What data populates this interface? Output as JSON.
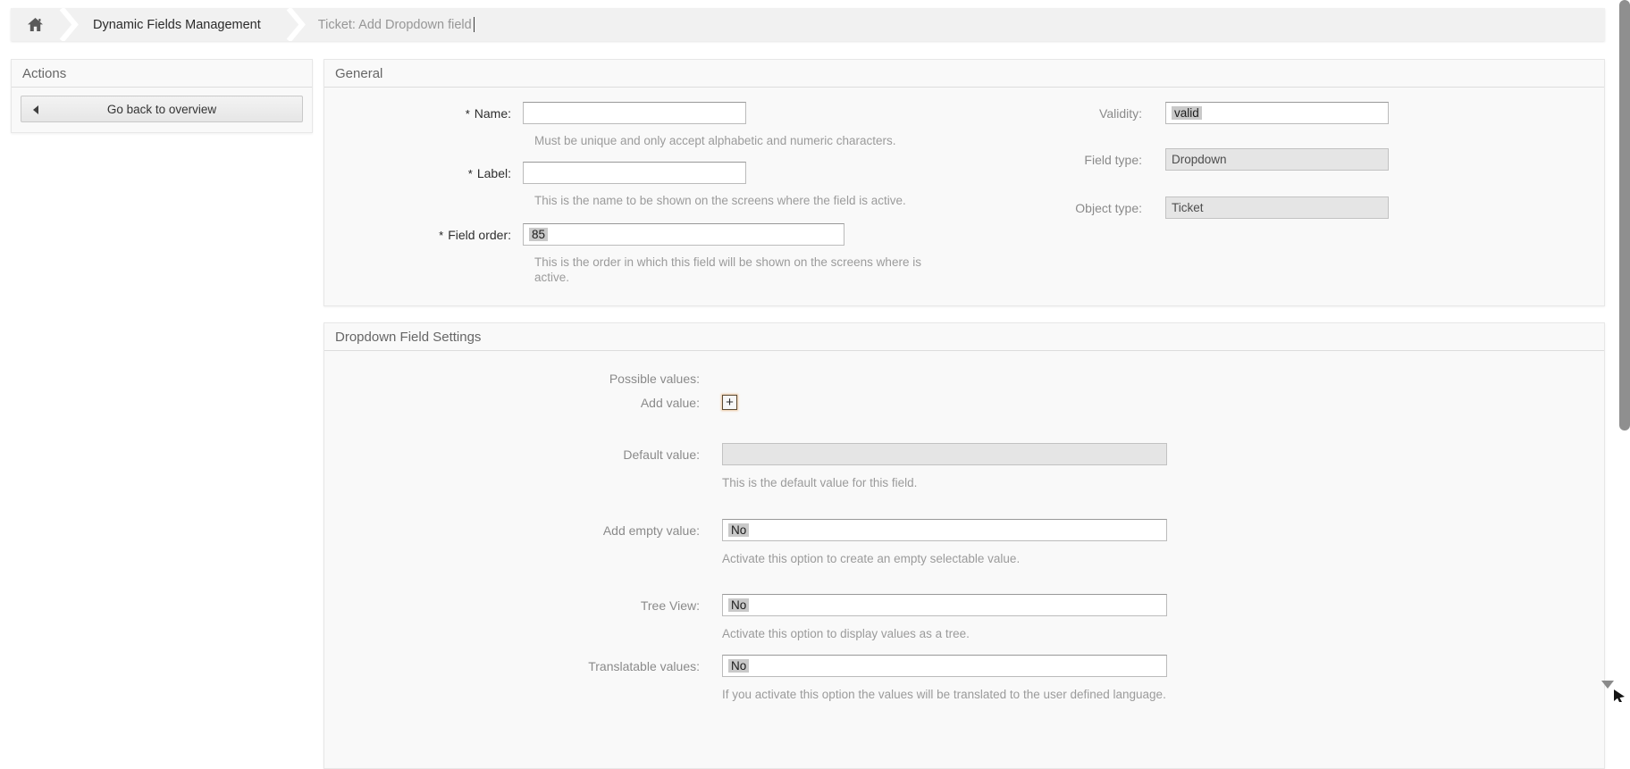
{
  "breadcrumb": {
    "item1": "Dynamic Fields Management",
    "item2": "Ticket: Add Dropdown field"
  },
  "actions": {
    "title": "Actions",
    "back_button_label": "Go back to overview"
  },
  "general": {
    "title": "General",
    "required_marker": "*",
    "name_label": "Name:",
    "name_value": "",
    "name_hint": "Must be unique and only accept alphabetic and numeric characters.",
    "label_label": "Label:",
    "label_value": "",
    "label_hint": "This is the name to be shown on the screens where the field is active.",
    "field_order_label": "Field order:",
    "field_order_value": "85",
    "field_order_hint": "This is the order in which this field will be shown on the screens where is active.",
    "validity_label": "Validity:",
    "validity_value": "valid",
    "field_type_label": "Field type:",
    "field_type_value": "Dropdown",
    "object_type_label": "Object type:",
    "object_type_value": "Ticket"
  },
  "settings": {
    "title": "Dropdown Field Settings",
    "possible_values_label": "Possible values:",
    "add_value_label": "Add value:",
    "default_value_label": "Default value:",
    "default_value_hint": "This is the default value for this field.",
    "add_empty_value_label": "Add empty value:",
    "add_empty_value_value": "No",
    "add_empty_value_hint": "Activate this option to create an empty selectable value.",
    "tree_view_label": "Tree View:",
    "tree_view_value": "No",
    "tree_view_hint": "Activate this option to display values as a tree.",
    "translatable_values_label": "Translatable values:",
    "translatable_values_value": "No",
    "translatable_values_hint": "If you activate this option the values will be translated to the user defined language."
  },
  "icons": {
    "add_value_plus": "+"
  },
  "colors": {
    "breadcrumb_bg": "#f1f1f1",
    "widget_bg": "#f9f9f9",
    "selection_bg": "#c9c9c9",
    "disabled_input_bg": "#e5e5e5",
    "scrollbar_thumb": "#8f8f8f"
  }
}
